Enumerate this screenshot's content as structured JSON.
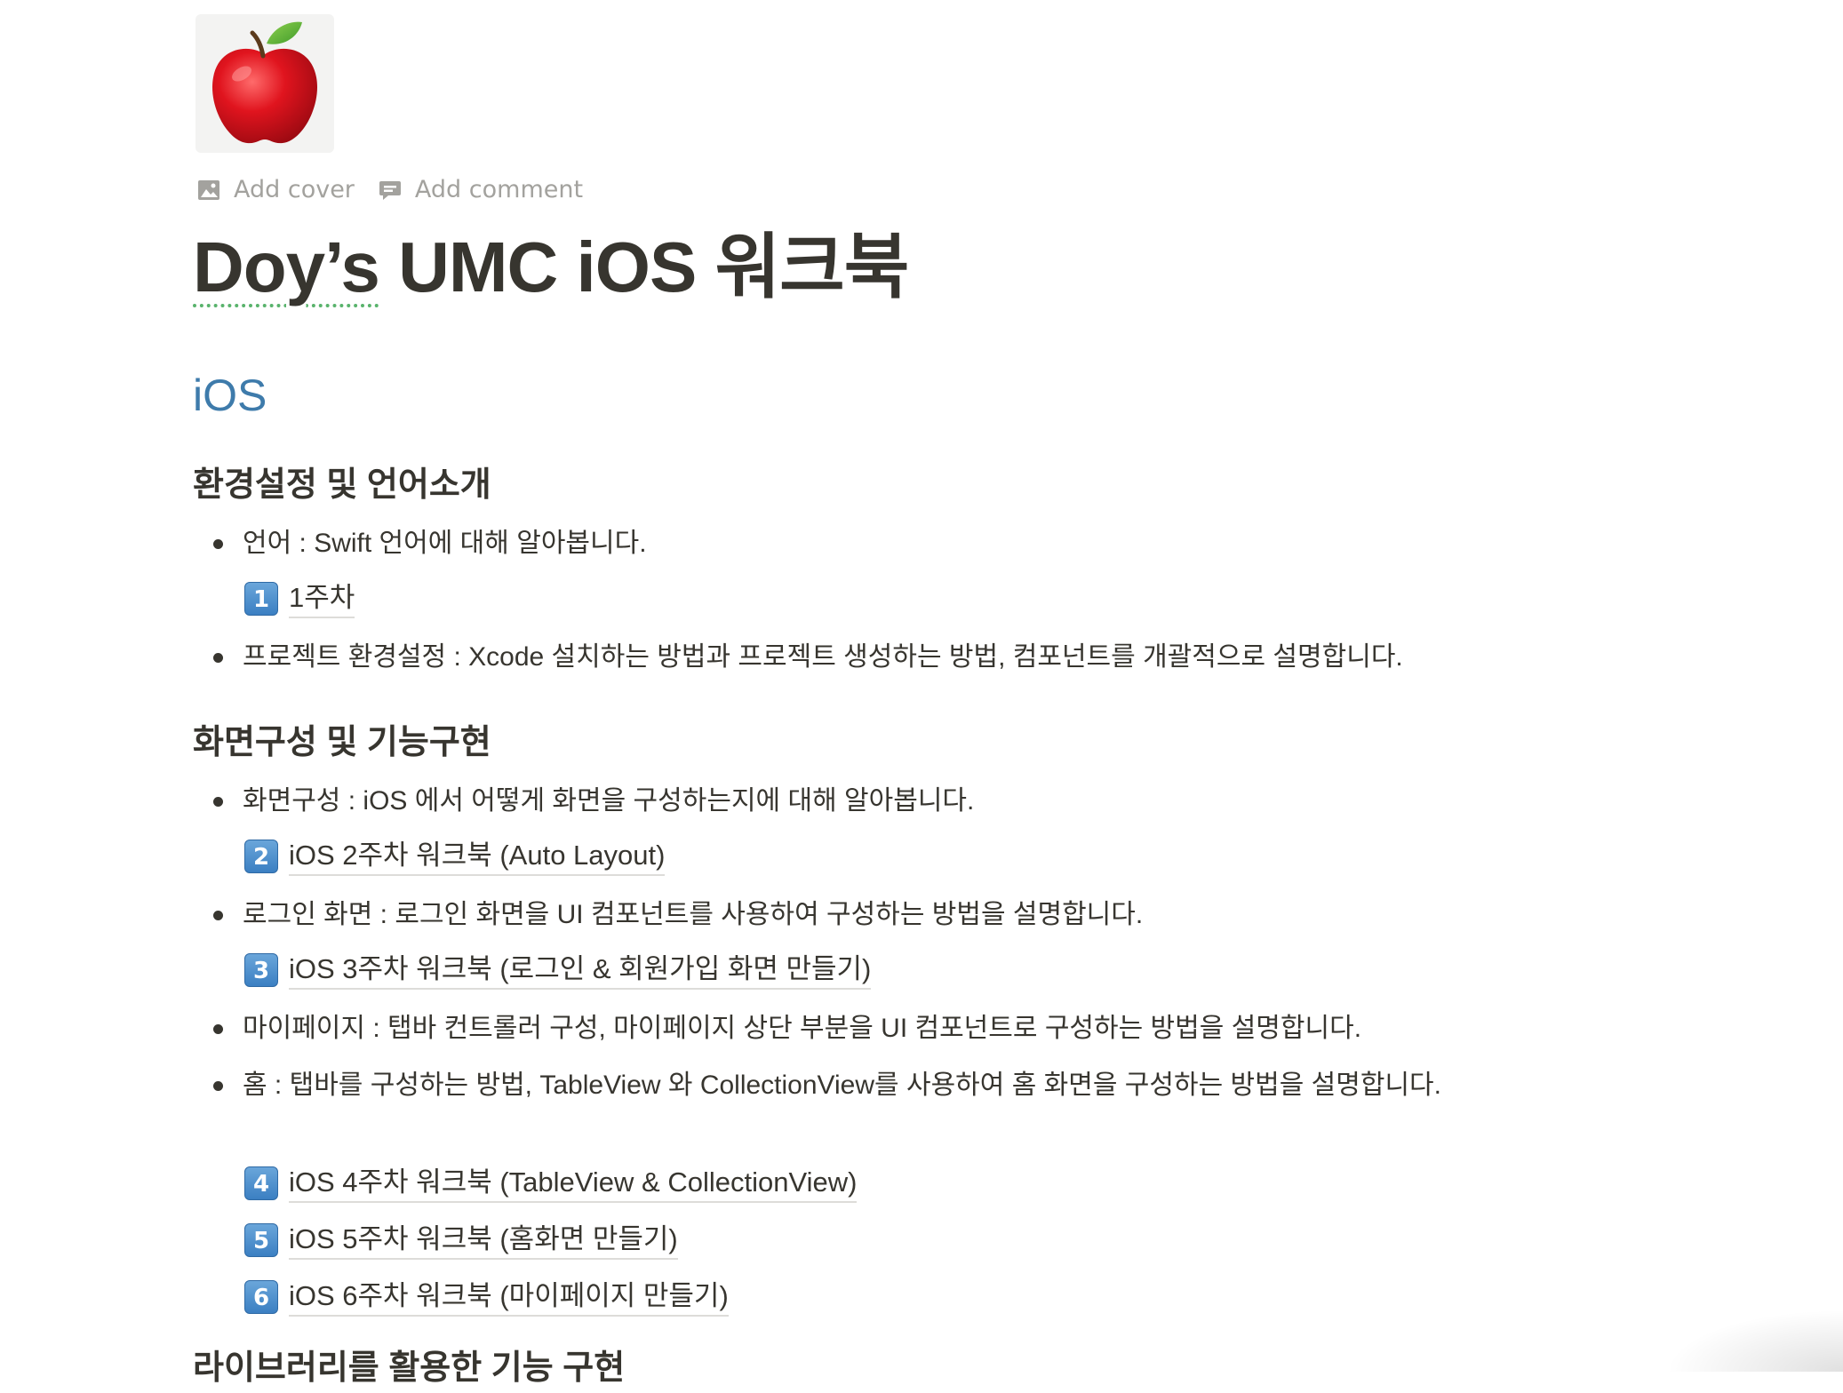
{
  "page": {
    "icon": "red-apple-icon",
    "controls": {
      "add_cover": "Add cover",
      "add_comment": "Add comment"
    },
    "title_part1": "Doy’s",
    "title_part2": " UMC iOS 워크북"
  },
  "content": {
    "heading1": "iOS",
    "section1": {
      "heading": "환경설정 및 언어소개",
      "bullet1": "언어 : Swift 언어에 대해 알아봅니다.",
      "link1": {
        "number": "1",
        "label": "1주차"
      },
      "bullet2": "프로젝트 환경설정 : Xcode 설치하는 방법과 프로젝트 생성하는 방법, 컴포넌트를 개괄적으로 설명합니다."
    },
    "section2": {
      "heading": "화면구성 및 기능구현",
      "bullet1": "화면구성 : iOS 에서 어떻게 화면을 구성하는지에 대해 알아봅니다.",
      "link2": {
        "number": "2",
        "label": "iOS 2주차 워크북 (Auto Layout)"
      },
      "bullet2": "로그인 화면 : 로그인 화면을 UI 컴포넌트를 사용하여 구성하는 방법을 설명합니다.",
      "link3": {
        "number": "3",
        "label": "iOS 3주차 워크북 (로그인 & 회원가입 화면 만들기)"
      },
      "bullet3": "마이페이지 : 탭바 컨트롤러 구성, 마이페이지 상단 부분을 UI 컴포넌트로 구성하는 방법을 설명합니다.",
      "bullet4": "홈 : 탭바를 구성하는 방법, TableView 와 CollectionView를 사용하여 홈 화면을 구성하는 방법을 설명합니다.",
      "link4": {
        "number": "4",
        "label": "iOS 4주차 워크북 (TableView & CollectionView)"
      },
      "link5": {
        "number": "5",
        "label": "iOS 5주차 워크북 (홈화면 만들기)"
      },
      "link6": {
        "number": "6",
        "label": "iOS 6주차 워크북 (마이페이지 만들기)"
      }
    },
    "section3": {
      "heading": "라이브러리를 활용한 기능 구현"
    }
  }
}
